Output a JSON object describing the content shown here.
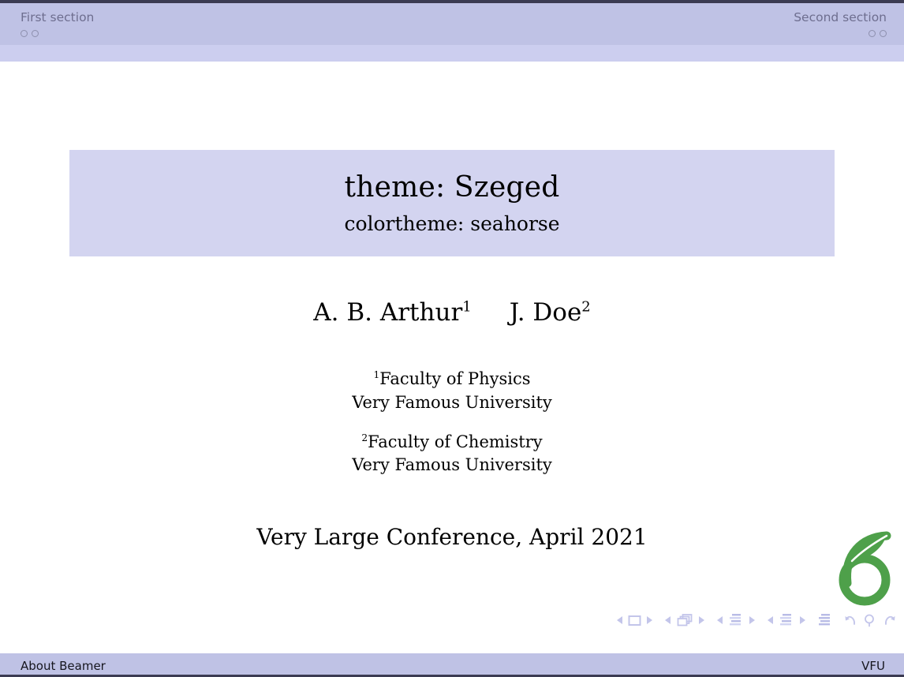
{
  "slide": {
    "colors": {
      "header_section_bar": "#bfc2e5",
      "header_subsection_bar": "#ccceef",
      "title_block_bg": "#d3d4f0",
      "footer_bar": "#bfc2e5",
      "rule_dark": "#3b3b52",
      "nav_text": "#6e6e8f",
      "nav_symbol": "#c3c5ea",
      "logo_green": "#4ea04a",
      "body_text": "#000000"
    }
  },
  "navigation": {
    "sections": [
      {
        "label": "First section",
        "frames": [
          "mini-frame-dot",
          "mini-frame-dot"
        ]
      },
      {
        "label": "Second section",
        "frames": [
          "mini-frame-dot",
          "mini-frame-dot"
        ]
      }
    ]
  },
  "title_block": {
    "title": "theme: Szeged",
    "subtitle": "colortheme: seahorse"
  },
  "authors": [
    {
      "name": "A. B. Arthur",
      "affiliation_mark": "1"
    },
    {
      "name": "J. Doe",
      "affiliation_mark": "2"
    }
  ],
  "institutes": [
    {
      "mark": "1",
      "department": "Faculty of Physics",
      "university": "Very Famous University"
    },
    {
      "mark": "2",
      "department": "Faculty of Chemistry",
      "university": "Very Famous University"
    }
  ],
  "date": "Very Large Conference, April 2021",
  "logo": {
    "name": "overleaf-logo",
    "color": "#4ea04a"
  },
  "nav_symbols": [
    {
      "name": "slide-navigation",
      "icons": [
        "triangle-left-icon",
        "square-icon",
        "triangle-right-icon"
      ]
    },
    {
      "name": "frame-navigation",
      "icons": [
        "triangle-left-icon",
        "stacked-frames-icon",
        "triangle-right-icon"
      ]
    },
    {
      "name": "subsection-navigation",
      "icons": [
        "triangle-left-icon",
        "subsection-lines-icon",
        "triangle-right-icon"
      ]
    },
    {
      "name": "section-navigation",
      "icons": [
        "triangle-left-icon",
        "section-lines-icon",
        "triangle-right-icon"
      ]
    },
    {
      "name": "presentation-navigation",
      "icons": [
        "document-lines-icon"
      ]
    },
    {
      "name": "misc-navigation",
      "icons": [
        "back-icon",
        "search-icon",
        "forward-icon"
      ]
    }
  ],
  "footer": {
    "left": "About Beamer",
    "right": "VFU"
  }
}
